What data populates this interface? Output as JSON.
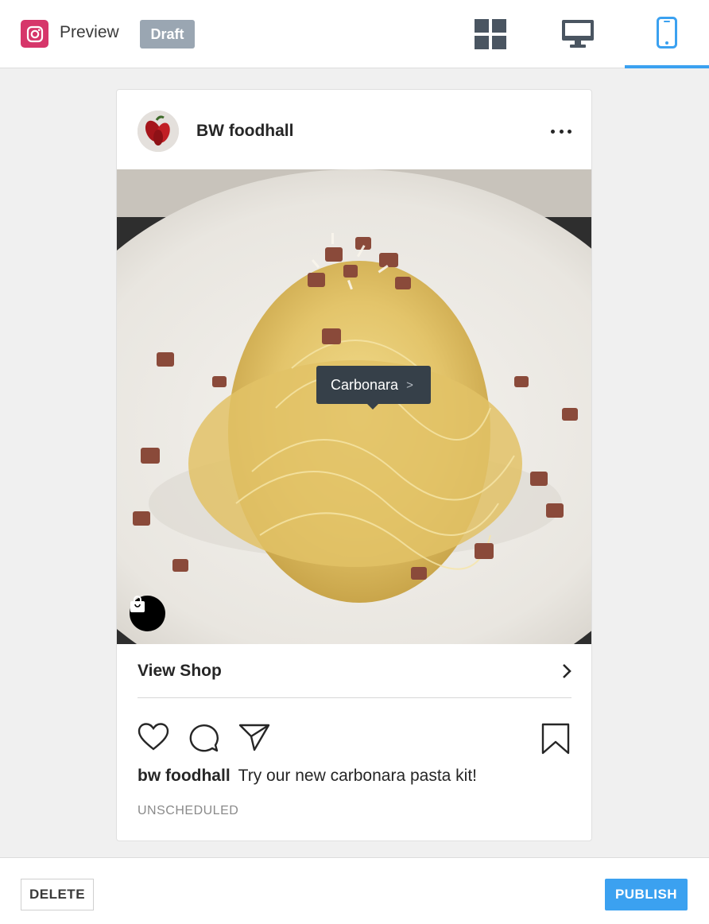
{
  "header": {
    "title": "Preview",
    "status_badge": "Draft",
    "view_tabs": [
      {
        "name": "grid",
        "icon": "grid-icon",
        "active": false
      },
      {
        "name": "desktop",
        "icon": "desktop-icon",
        "active": false
      },
      {
        "name": "mobile",
        "icon": "mobile-phone-icon",
        "active": true
      }
    ]
  },
  "post": {
    "account_name": "BW foodhall",
    "product_tag": "Carbonara",
    "product_tag_chevron": ">",
    "view_shop_label": "View Shop",
    "caption_user": "bw foodhall",
    "caption_text": "Try our new carbonara pasta kit!",
    "schedule_status": "UNSCHEDULED"
  },
  "footer": {
    "delete_label": "DELETE",
    "publish_label": "PUBLISH"
  },
  "colors": {
    "accent": "#3ba1f0",
    "instagram": "#d6366a",
    "draft_badge": "#9aa6b2",
    "tag_background": "#364049"
  }
}
